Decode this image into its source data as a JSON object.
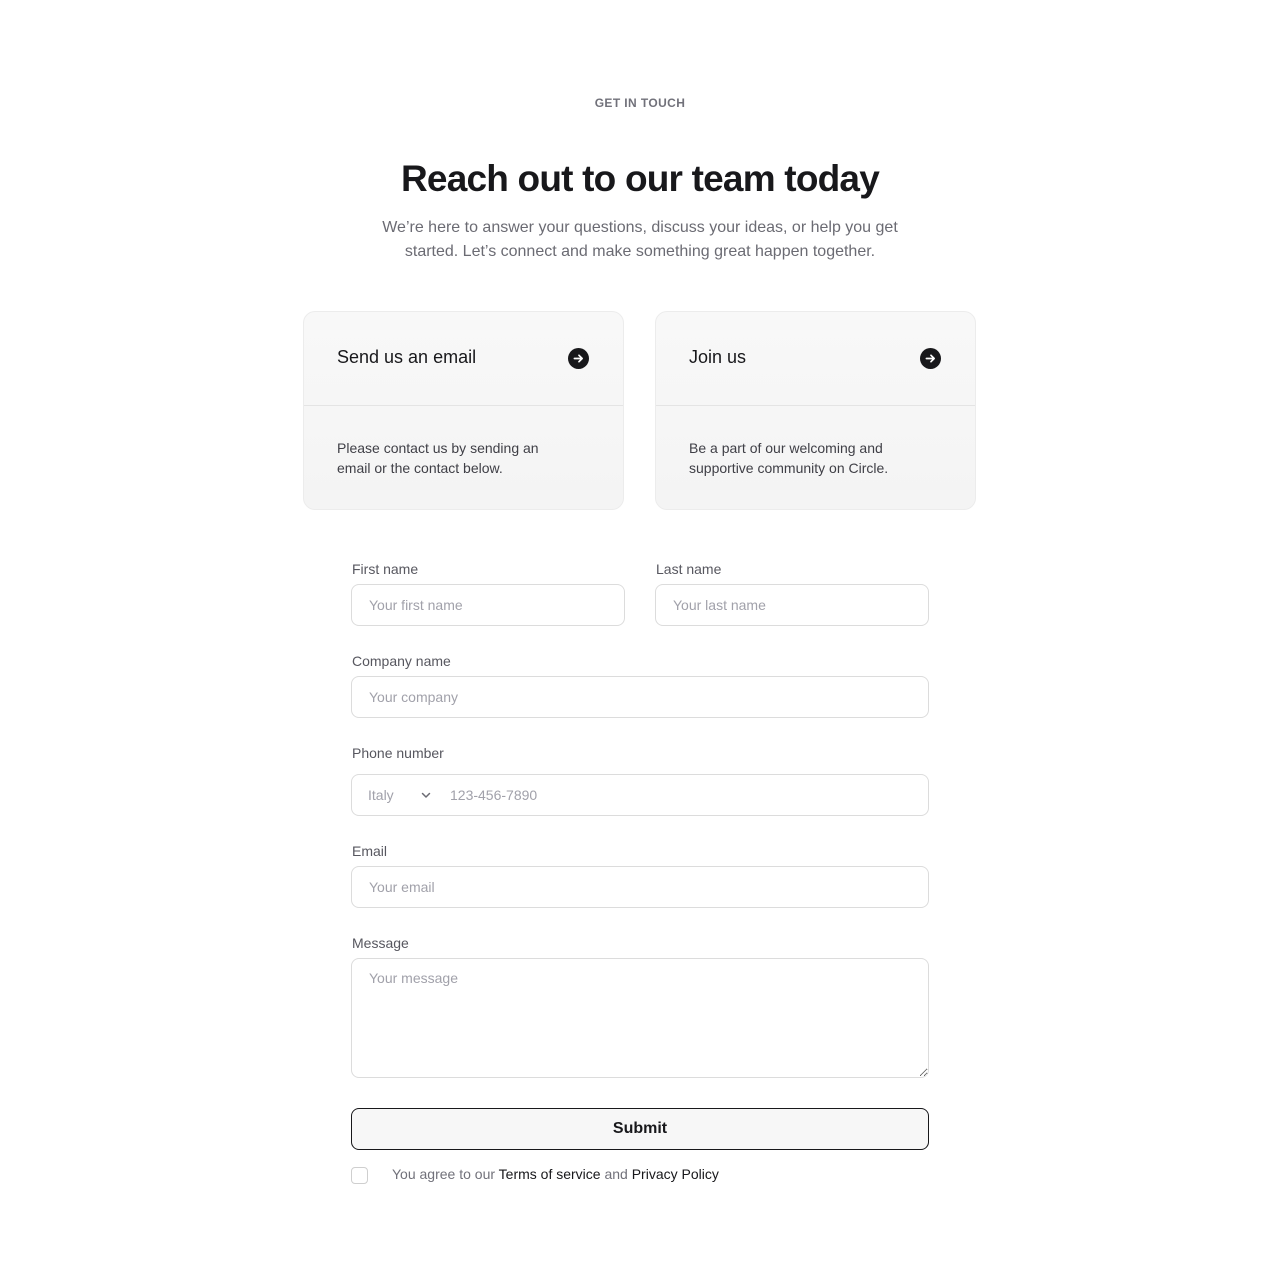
{
  "header": {
    "eyebrow": "GET IN TOUCH",
    "title": "Reach out to our team today",
    "subtitle": "We’re here to answer your questions, discuss your ideas, or help you get started. Let’s connect and make something great happen together."
  },
  "cards": [
    {
      "title": "Send us an email",
      "description": "Please contact us by sending an email or the contact below.",
      "icon": "arrow-right-circle-icon"
    },
    {
      "title": "Join us",
      "description": "Be a part of our welcoming and supportive community on Circle.",
      "icon": "arrow-right-circle-icon"
    }
  ],
  "form": {
    "first_name": {
      "label": "First name",
      "placeholder": "Your first name",
      "value": ""
    },
    "last_name": {
      "label": "Last name",
      "placeholder": "Your last name",
      "value": ""
    },
    "company": {
      "label": "Company name",
      "placeholder": "Your company",
      "value": ""
    },
    "phone": {
      "label": "Phone number",
      "country": "Italy",
      "country_icon": "chevron-down-icon",
      "placeholder": "123-456-7890",
      "value": ""
    },
    "email": {
      "label": "Email",
      "placeholder": "Your email",
      "value": ""
    },
    "message": {
      "label": "Message",
      "placeholder": "Your message",
      "value": ""
    },
    "submit_label": "Submit",
    "agreement": {
      "checked": false,
      "prefix": "You agree to our",
      "terms_link": "Terms of service",
      "connector": "and",
      "privacy_link": "Privacy Policy"
    }
  },
  "colors": {
    "text_primary": "#18181b",
    "text_muted": "#71717a",
    "border": "#dcdcdc",
    "card_bg": "#f6f6f6"
  }
}
